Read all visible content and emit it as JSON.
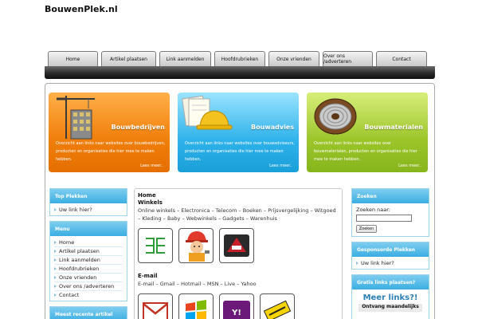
{
  "site": {
    "title": "BouwenPlek.nl"
  },
  "nav": {
    "items": [
      {
        "label": "Home"
      },
      {
        "label": "Artikel plaatsen"
      },
      {
        "label": "Link aanmelden"
      },
      {
        "label": "Hoofdrubrieken"
      },
      {
        "label": "Onze vrienden"
      },
      {
        "label": "Over ons /adverteren"
      },
      {
        "label": "Contact"
      }
    ]
  },
  "features": [
    {
      "title": "Bouwbedrijven",
      "desc": "Overzicht aan links naar websites over bouwbedrijven, producten en organisaties die hier mee te maken hebben.",
      "more": "Lees meer..",
      "color": "#f07e0a",
      "icon": "crane-building-icon"
    },
    {
      "title": "Bouwadvies",
      "desc": "Overzicht aan links naar websites over bouwadviseurs, producten en organisaties die hier mee te maken hebben.",
      "more": "Lees meer..",
      "color": "#2fb2ea",
      "icon": "hardhat-documents-icon"
    },
    {
      "title": "Bouwmaterialen",
      "desc": "Overzicht aan links naar websites over bouwmaterialen, producten en organisaties die hier mee te maken hebben.",
      "more": "Lees meer..",
      "color": "#9cc52a",
      "icon": "cable-reel-icon"
    }
  ],
  "left_sidebar": {
    "top": {
      "heading": "Top Plekken",
      "items": [
        "Uw link hier?"
      ]
    },
    "menu": {
      "heading": "Menu",
      "items": [
        "Home",
        "Artikel plaatsen",
        "Link aanmelden",
        "Hoofdrubrieken",
        "Onze vrienden",
        "Over ons /adverteren",
        "Contact"
      ]
    },
    "recent": {
      "heading": "Meest recente artikel"
    }
  },
  "main": {
    "heading": "Home",
    "section1": {
      "title": "Winkels",
      "links": "Online winkels – Electronica – Telecom – Boeken – Prijsvergelijking – Witgoed – Kleding – Baby – Webwinkels – Gadgets – Warenhuis"
    },
    "section2": {
      "title": "E-mail",
      "links": "E-mail – Gmail – Hotmail – MSN – Live – Yahoo"
    },
    "tiles1": [
      "ee-logo-icon",
      "worker-cartoon-icon",
      "dark-logo-icon"
    ],
    "tiles2": [
      "gmail-icon",
      "windows-icon",
      "yahoo-icon",
      "xs4all-icon"
    ]
  },
  "right_sidebar": {
    "search": {
      "heading": "Zoeken",
      "label": "Zoeken naar:",
      "placeholder": "",
      "button": "Zoeken"
    },
    "sponsored": {
      "heading": "Gesponsorde Plekken",
      "items": [
        "Uw link hier?"
      ]
    },
    "free": {
      "heading": "Gratis links plaatsen?",
      "big": "Meer links?!",
      "small": "Ontvang maandelijks"
    }
  },
  "colors": {
    "accent": "#3aaee2",
    "nav_dark": "#1a1a1a",
    "link_blue": "#2a7fb5"
  }
}
